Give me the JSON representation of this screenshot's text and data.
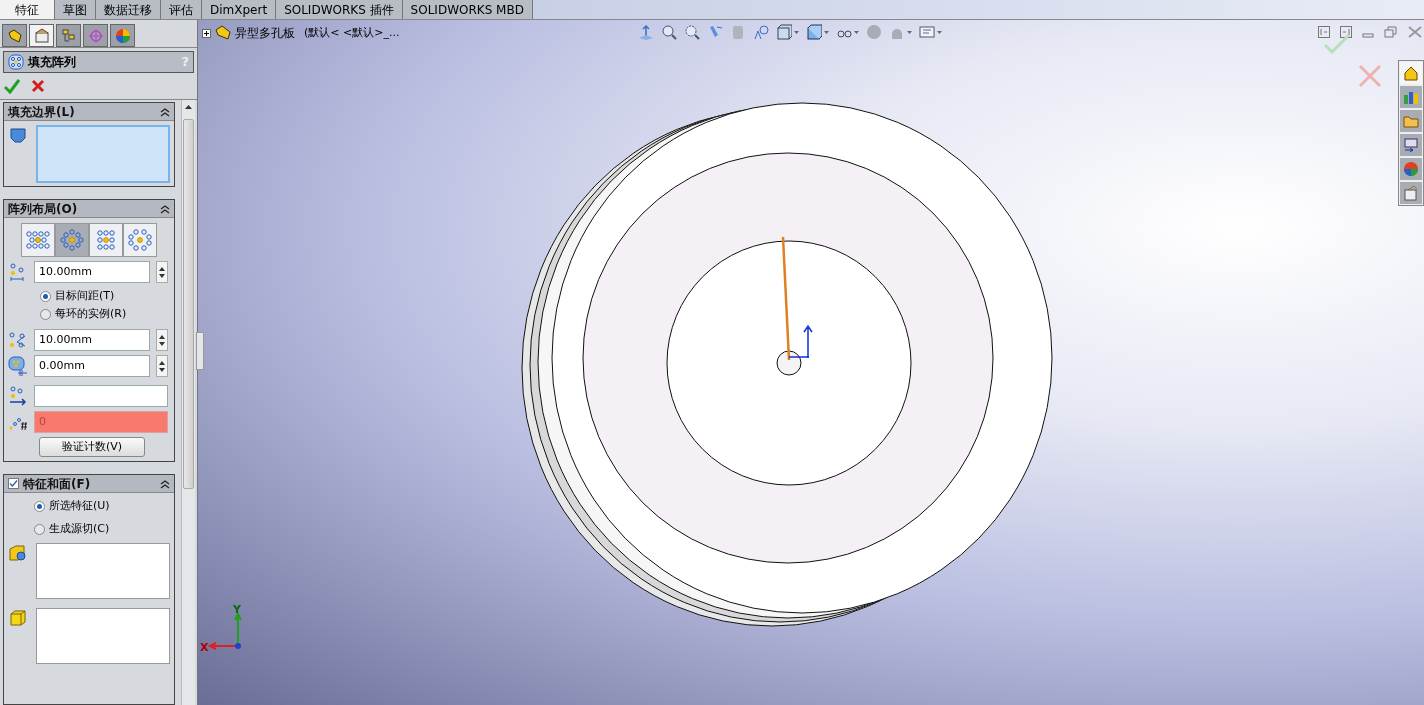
{
  "tabs": [
    {
      "label": "特征",
      "selected": true
    },
    {
      "label": "草图",
      "selected": false
    },
    {
      "label": "数据迁移",
      "selected": false
    },
    {
      "label": "评估",
      "selected": false
    },
    {
      "label": "DimXpert",
      "selected": false
    },
    {
      "label": "SOLIDWORKS 插件",
      "selected": false
    },
    {
      "label": "SOLIDWORKS MBD",
      "selected": false
    }
  ],
  "panel_tabs": [
    {
      "selected": false
    },
    {
      "selected": true
    },
    {
      "selected": false
    },
    {
      "selected": false
    },
    {
      "selected": false
    }
  ],
  "property_manager": {
    "title": "填充阵列",
    "help": "?"
  },
  "fill_boundary": {
    "title": "填充边界(L)"
  },
  "pattern_layout": {
    "title": "阵列布局(O)",
    "layouts": [
      {
        "selected": false
      },
      {
        "selected": true
      },
      {
        "selected": false
      },
      {
        "selected": false
      }
    ],
    "spacing": "10.00mm",
    "radios": [
      {
        "label": "目标间距(T)",
        "selected": true
      },
      {
        "label": "每环的实例(R)",
        "selected": false
      }
    ],
    "angle": "10.00mm",
    "margin": "0.00mm",
    "count": "0",
    "count_error": true,
    "verify_button": "验证计数(V)"
  },
  "features_and_faces": {
    "title": "特征和面(F)",
    "checked": true,
    "radios": [
      {
        "label": "所选特征(U)",
        "selected": true
      },
      {
        "label": "生成源切(C)",
        "selected": false
      }
    ]
  },
  "tree": {
    "name": "异型多孔板",
    "config": "(默认< <默认>_..."
  },
  "triad": {
    "y": "Y",
    "x": "X"
  },
  "task_pane": [
    {
      "selected": true
    },
    {
      "selected": false
    },
    {
      "selected": false
    },
    {
      "selected": false
    },
    {
      "selected": false
    },
    {
      "selected": false
    }
  ]
}
